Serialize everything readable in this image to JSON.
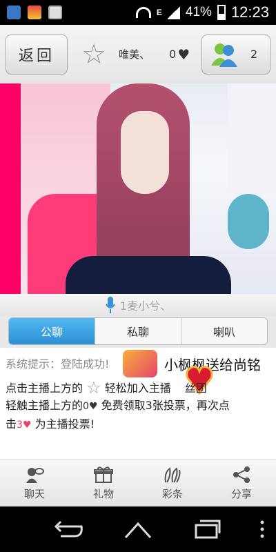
{
  "status_bar": {
    "battery": "41%",
    "time": "12:23",
    "network": "E"
  },
  "header": {
    "back_label": "返回",
    "anchor_name": "唯美、",
    "heart_count": "0",
    "user_count": "2"
  },
  "mic": {
    "label": "1麦小兮、"
  },
  "tabs": [
    {
      "label": "公聊",
      "active": true
    },
    {
      "label": "私聊",
      "active": false
    },
    {
      "label": "喇叭",
      "active": false
    }
  ],
  "chat": {
    "system_text": "系统提示：登陆成功!",
    "gift_text": "小枫枫送给尚铭",
    "line1_a": "点击主播上方的",
    "line1_b": "轻松加入主播",
    "line1_c": "丝团",
    "line2_a": "轻触主播上方的",
    "line2_zero": "0",
    "line2_b": "免费领取3张投票，再次点",
    "line3_a": "击",
    "line3_num": "3",
    "line3_b": "为主播投票!"
  },
  "bottom_nav": [
    {
      "label": "聊天",
      "icon": "chat-icon"
    },
    {
      "label": "礼物",
      "icon": "gift-icon"
    },
    {
      "label": "彩条",
      "icon": "ribbon-icon"
    },
    {
      "label": "分享",
      "icon": "share-icon"
    }
  ],
  "colors": {
    "accent": "#2d8fd6",
    "heart": "#e8446a"
  }
}
